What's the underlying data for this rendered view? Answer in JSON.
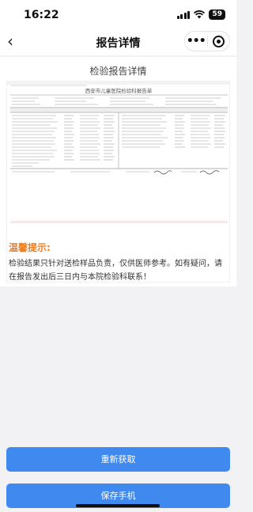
{
  "status_bar": {
    "time": "16:22",
    "battery": "59"
  },
  "nav": {
    "back": "‹",
    "title": "报告详情",
    "more": "•••"
  },
  "content": {
    "heading": "检验报告详情"
  },
  "report": {
    "title": "西安市儿童医院检验科报告单"
  },
  "tips": {
    "title": "温馨提示:",
    "body": "检验结果只针对送检样品负责，仅供医师参考。如有疑问，请在报告发出后三日内与本院检验科联系！"
  },
  "actions": {
    "refresh_label": "重新获取",
    "save_label": "保存手机"
  },
  "colors": {
    "accent": "#3f89ef",
    "tips": "#f07c1d"
  }
}
